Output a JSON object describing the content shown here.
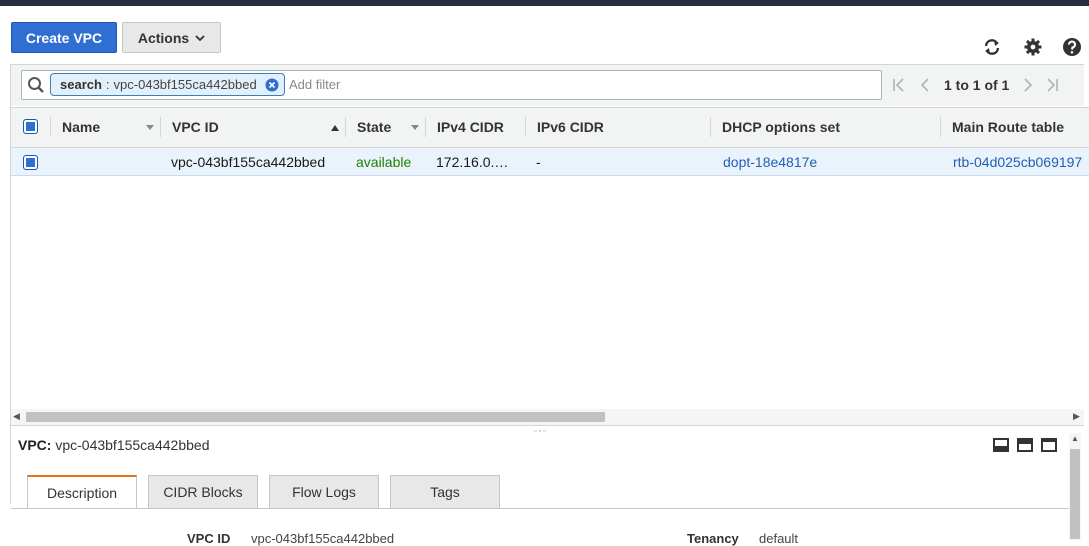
{
  "toolbar": {
    "create_label": "Create VPC",
    "actions_label": "Actions",
    "refresh_icon": "refresh-icon",
    "settings_icon": "gear-icon",
    "help_icon": "help-icon"
  },
  "filter": {
    "token_key": "search",
    "token_sep": ":",
    "token_value": "vpc-043bf155ca442bbed",
    "placeholder": "Add filter"
  },
  "pagination": {
    "text": "1 to 1 of 1"
  },
  "table": {
    "columns": [
      "Name",
      "VPC ID",
      "State",
      "IPv4 CIDR",
      "IPv6 CIDR",
      "DHCP options set",
      "Main Route table"
    ],
    "rows": [
      {
        "name": "",
        "vpc_id": "vpc-043bf155ca442bbed",
        "state": "available",
        "ipv4": "172.16.0.…",
        "ipv6": "-",
        "dhcp": "dopt-18e4817e",
        "route_table": "rtb-04d025cb069197"
      }
    ]
  },
  "detail": {
    "title_label": "VPC:",
    "title_value": "vpc-043bf155ca442bbed",
    "tabs": [
      "Description",
      "CIDR Blocks",
      "Flow Logs",
      "Tags"
    ],
    "fields": [
      {
        "label": "VPC ID",
        "value": "vpc-043bf155ca442bbed"
      },
      {
        "label": "Tenancy",
        "value": "default"
      }
    ]
  },
  "colors": {
    "primary": "#2e6fd1",
    "link": "#1f5fb5",
    "available": "#1d8102",
    "tab_accent": "#ec7211"
  }
}
